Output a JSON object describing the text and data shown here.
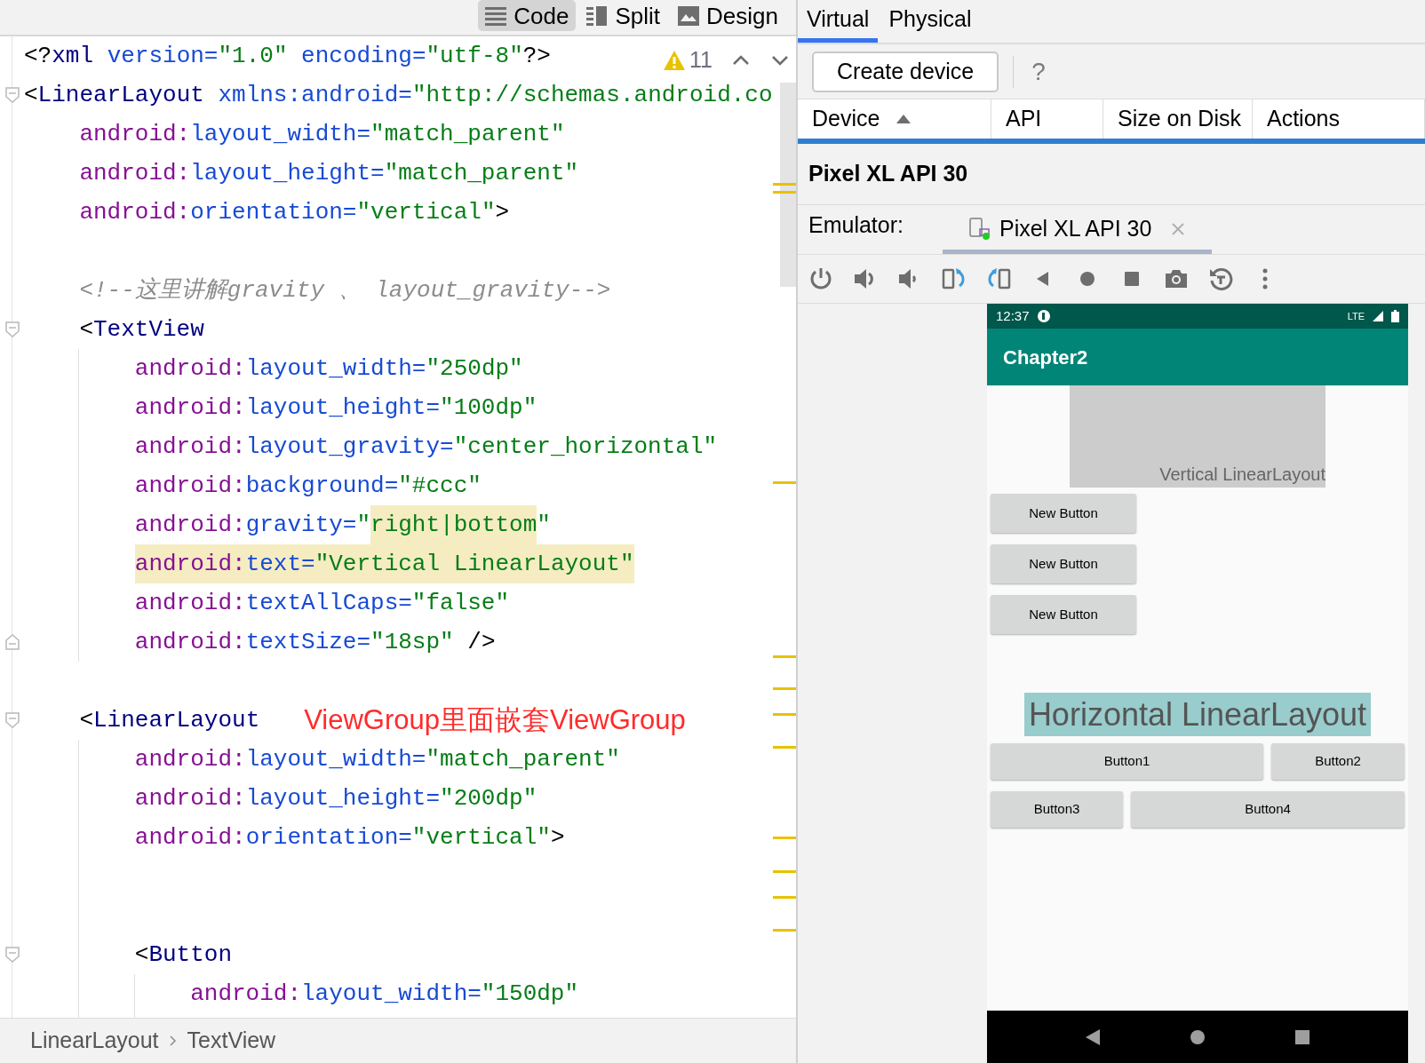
{
  "editor": {
    "view_modes": [
      {
        "label": "Code",
        "selected": true
      },
      {
        "label": "Split",
        "selected": false
      },
      {
        "label": "Design",
        "selected": false
      }
    ],
    "warnings": "11",
    "lines": [
      {
        "kind": "plain",
        "tokens": [
          {
            "kind": "punct",
            "text": "<?"
          },
          {
            "kind": "tag",
            "text": "xml"
          },
          {
            "kind": "attr",
            "text": " version="
          },
          {
            "kind": "value",
            "text": "\"1.0\""
          },
          {
            "kind": "attr",
            "text": " encoding="
          },
          {
            "kind": "value",
            "text": "\"utf-8\""
          },
          {
            "kind": "punct",
            "text": "?>"
          }
        ]
      },
      {
        "kind": "block-start",
        "tokens": [
          {
            "kind": "punct",
            "text": "<"
          },
          {
            "kind": "tag",
            "text": "LinearLayout"
          },
          {
            "kind": "attr",
            "text": " xmlns:android="
          },
          {
            "kind": "value",
            "text": "\"http://schemas.android.co"
          }
        ]
      },
      {
        "kind": "plain",
        "tokens": [
          {
            "kind": "ns",
            "text": "android:"
          },
          {
            "kind": "attr",
            "text": "layout_width="
          },
          {
            "kind": "value",
            "text": "\"match_parent\""
          }
        ]
      },
      {
        "kind": "plain",
        "tokens": [
          {
            "kind": "ns",
            "text": "android:"
          },
          {
            "kind": "attr",
            "text": "layout_height="
          },
          {
            "kind": "value",
            "text": "\"match_parent\""
          }
        ]
      },
      {
        "kind": "plain",
        "tokens": [
          {
            "kind": "ns",
            "text": "android:"
          },
          {
            "kind": "attr",
            "text": "orientation="
          },
          {
            "kind": "value",
            "text": "\"vertical\""
          },
          {
            "kind": "punct",
            "text": ">"
          }
        ]
      },
      {
        "kind": "plain"
      },
      {
        "kind": "plain",
        "tokens": [
          {
            "kind": "comment",
            "text": "<!--这里讲解gravity 、 layout_gravity-->"
          }
        ]
      },
      {
        "kind": "block-start",
        "tokens": [
          {
            "kind": "punct",
            "text": "<"
          },
          {
            "kind": "tag",
            "text": "TextView"
          }
        ]
      },
      {
        "kind": "plain",
        "tokens": [
          {
            "kind": "ns",
            "text": "android:"
          },
          {
            "kind": "attr",
            "text": "layout_width="
          },
          {
            "kind": "value",
            "text": "\"250dp\""
          }
        ]
      },
      {
        "kind": "plain",
        "tokens": [
          {
            "kind": "ns",
            "text": "android:"
          },
          {
            "kind": "attr",
            "text": "layout_height="
          },
          {
            "kind": "value",
            "text": "\"100dp\""
          }
        ]
      },
      {
        "kind": "plain",
        "tokens": [
          {
            "kind": "ns",
            "text": "android:"
          },
          {
            "kind": "attr",
            "text": "layout_gravity="
          },
          {
            "kind": "value",
            "text": "\"center_horizontal\""
          }
        ]
      },
      {
        "kind": "plain",
        "tokens": [
          {
            "kind": "ns",
            "text": "android:"
          },
          {
            "kind": "attr",
            "text": "background="
          },
          {
            "kind": "value",
            "text": "\"#ccc\""
          }
        ]
      },
      {
        "kind": "plain",
        "tokens": [
          {
            "kind": "ns",
            "text": "android:"
          },
          {
            "kind": "attr",
            "text": "gravity="
          },
          {
            "kind": "value",
            "text": "\""
          },
          {
            "kind": "value",
            "text": "right|bottom",
            "highlighted": true
          },
          {
            "kind": "value",
            "text": "\""
          }
        ]
      },
      {
        "kind": "plain",
        "highlighted": true,
        "tokens": [
          {
            "kind": "ns",
            "text": "android:"
          },
          {
            "kind": "attr",
            "text": "text="
          },
          {
            "kind": "value",
            "text": "\"Vertical LinearLayout\""
          }
        ]
      },
      {
        "kind": "plain",
        "tokens": [
          {
            "kind": "ns",
            "text": "android:"
          },
          {
            "kind": "attr",
            "text": "textAllCaps="
          },
          {
            "kind": "value",
            "text": "\"false\""
          }
        ]
      },
      {
        "kind": "block-end",
        "tokens": [
          {
            "kind": "ns",
            "text": "android:"
          },
          {
            "kind": "attr",
            "text": "textSize="
          },
          {
            "kind": "value",
            "text": "\"18sp\""
          },
          {
            "kind": "punct",
            "text": " />"
          }
        ]
      },
      {
        "kind": "plain"
      },
      {
        "kind": "block-start",
        "tokens": [
          {
            "kind": "punct",
            "text": "<"
          },
          {
            "kind": "tag",
            "text": "LinearLayout"
          }
        ],
        "annotation": "ViewGroup里面嵌套ViewGroup"
      },
      {
        "kind": "plain",
        "tokens": [
          {
            "kind": "ns",
            "text": "android:"
          },
          {
            "kind": "attr",
            "text": "layout_width="
          },
          {
            "kind": "value",
            "text": "\"match_parent\""
          }
        ]
      },
      {
        "kind": "plain",
        "tokens": [
          {
            "kind": "ns",
            "text": "android:"
          },
          {
            "kind": "attr",
            "text": "layout_height="
          },
          {
            "kind": "value",
            "text": "\"200dp\""
          }
        ]
      },
      {
        "kind": "plain",
        "tokens": [
          {
            "kind": "ns",
            "text": "android:"
          },
          {
            "kind": "attr",
            "text": "orientation="
          },
          {
            "kind": "value",
            "text": "\"vertical\""
          },
          {
            "kind": "punct",
            "text": ">"
          }
        ]
      },
      {
        "kind": "plain"
      },
      {
        "kind": "plain"
      },
      {
        "kind": "block-start",
        "tokens": [
          {
            "kind": "punct",
            "text": "<"
          },
          {
            "kind": "tag",
            "text": "Button"
          }
        ]
      },
      {
        "kind": "plain",
        "tokens": [
          {
            "kind": "ns",
            "text": "android:"
          },
          {
            "kind": "attr",
            "text": "layout_width="
          },
          {
            "kind": "value",
            "text": "\"150dp\""
          }
        ]
      }
    ],
    "breadcrumb": [
      "LinearLayout",
      "TextView"
    ]
  },
  "device_manager": {
    "tabs": [
      {
        "label": "Virtual",
        "selected": true
      },
      {
        "label": "Physical",
        "selected": false
      }
    ],
    "create_button": "Create device",
    "help": "?",
    "columns": [
      {
        "label": "Device",
        "sorted": true
      },
      {
        "label": "API",
        "sorted": false
      },
      {
        "label": "Size on Disk",
        "sorted": false
      },
      {
        "label": "Actions",
        "sorted": false
      }
    ],
    "device_title": "Pixel XL API 30",
    "emulator_label": "Emulator:",
    "emulator_tabs": [
      {
        "label": "Pixel XL API 30",
        "selected": true
      }
    ]
  },
  "phone": {
    "time": "12:37",
    "network": "LTE",
    "app_title": "Chapter2",
    "text_view": "Vertical LinearLayout",
    "vertical_buttons": [
      "New Button",
      "New Button",
      "New Button"
    ],
    "heading": "Horizontal LinearLayout",
    "button_rows": [
      [
        "Button1",
        "Button2"
      ],
      [
        "Button3",
        "Button4"
      ]
    ]
  }
}
